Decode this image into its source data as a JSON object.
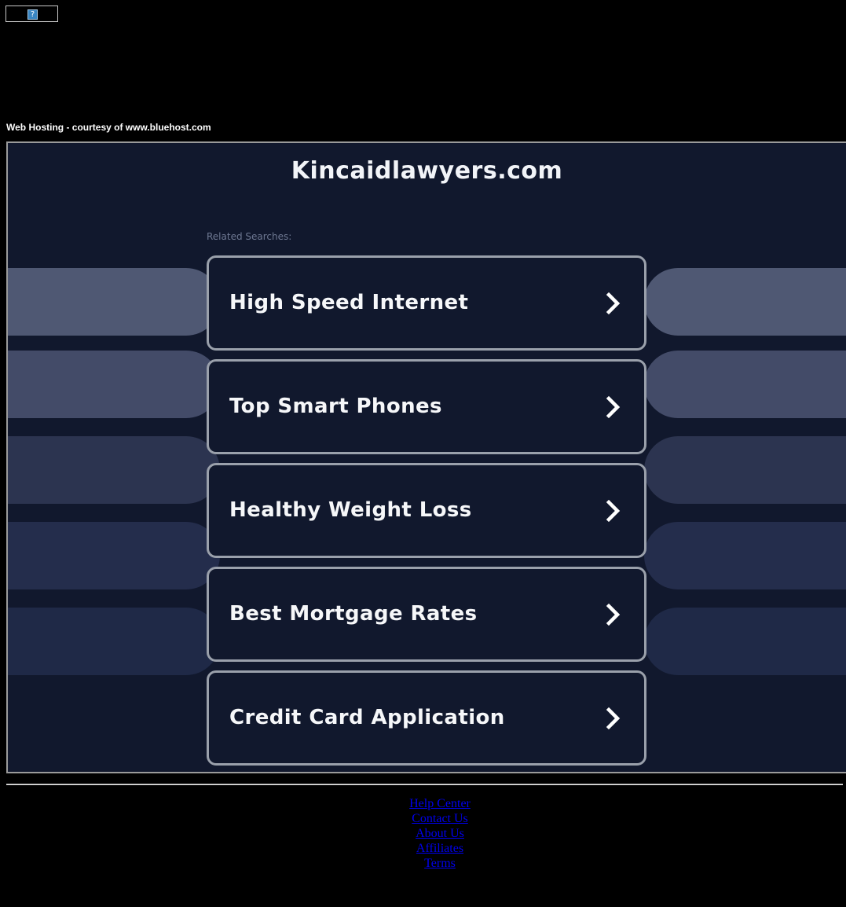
{
  "page": {
    "hosting_note": "Web Hosting - courtesy of www.bluehost.com",
    "broken_image_glyph": "?"
  },
  "main": {
    "site_title": "Kincaidlawyers.com",
    "related_label": "Related Searches:",
    "searches": [
      {
        "label": "High Speed Internet"
      },
      {
        "label": "Top Smart Phones"
      },
      {
        "label": "Healthy Weight Loss"
      },
      {
        "label": "Best Mortgage Rates"
      },
      {
        "label": "Credit Card Application"
      }
    ],
    "icons": {
      "search_arrow": "chevron-right-icon"
    }
  },
  "footer": {
    "links": [
      {
        "label": "Help Center"
      },
      {
        "label": "Contact Us"
      },
      {
        "label": "About Us"
      },
      {
        "label": "Affiliates"
      },
      {
        "label": "Terms"
      }
    ]
  },
  "colors": {
    "page_background": "#000000",
    "panel_background": "#11182d",
    "button_border": "#9aa0ab",
    "link": "#0000ee",
    "bar_shades": [
      "#4f5873",
      "#434b68",
      "#2c3450",
      "#242d4c",
      "#1f2947"
    ]
  }
}
